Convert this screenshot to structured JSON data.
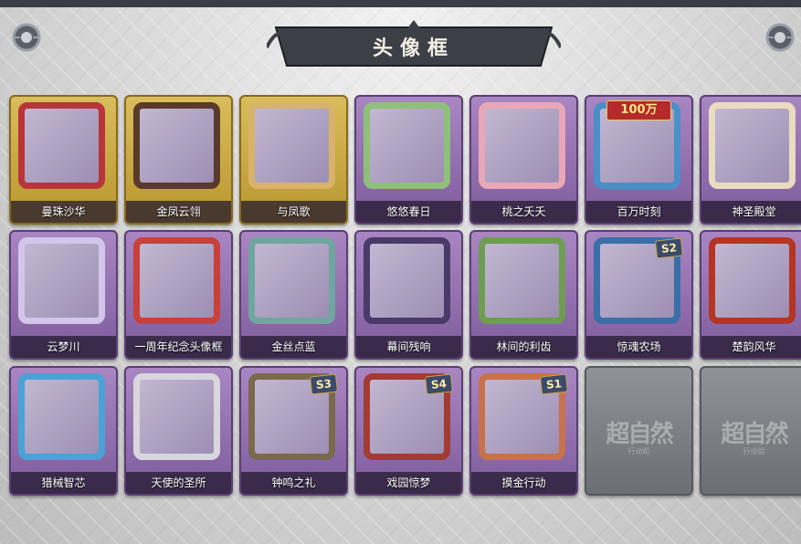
{
  "header": {
    "title": "头像框"
  },
  "colors": {
    "gold_card": "#c9a84a",
    "purple_card": "#9877b4",
    "locked_card": "#7d8186",
    "title_banner": "#3d3f46"
  },
  "frames": [
    {
      "label": "曼珠沙华",
      "style": "gold",
      "frame_color": "#b9353a",
      "icon": "spider-lily-icon"
    },
    {
      "label": "金凤云翎",
      "style": "gold",
      "frame_color": "#5a3a2a",
      "icon": "phoenix-feather-icon"
    },
    {
      "label": "与凤歌",
      "style": "gold",
      "frame_color": "#d8b36a",
      "icon": "phoenix-icon"
    },
    {
      "label": "悠悠春日",
      "style": "purple",
      "frame_color": "#8fc07a",
      "icon": "flower-icon"
    },
    {
      "label": "桃之夭夭",
      "style": "purple",
      "frame_color": "#e9a7b8",
      "icon": "peach-blossom-icon"
    },
    {
      "label": "百万时刻",
      "style": "purple",
      "frame_color": "#4a8fc8",
      "icon": "fox-icon",
      "badge_top": "100万"
    },
    {
      "label": "神圣殿堂",
      "style": "purple",
      "frame_color": "#e9dcc0",
      "icon": "heart-crest-icon"
    },
    {
      "label": "云梦川",
      "style": "purple",
      "frame_color": "#d2c6ea",
      "icon": "cloud-icon"
    },
    {
      "label": "一周年纪念头像框",
      "style": "purple",
      "frame_color": "#c8403a",
      "icon": "anniversary-cake-icon"
    },
    {
      "label": "金丝点蓝",
      "style": "purple",
      "frame_color": "#6fa6a0",
      "icon": "tulip-icon"
    },
    {
      "label": "幕间残响",
      "style": "purple",
      "frame_color": "#4a3a6a",
      "icon": "rose-icon"
    },
    {
      "label": "林间的利齿",
      "style": "purple",
      "frame_color": "#6d9e4f",
      "icon": "wolf-icon"
    },
    {
      "label": "惊魂农场",
      "style": "purple",
      "frame_color": "#3a6fa8",
      "icon": "sprout-icon",
      "badge": "S2"
    },
    {
      "label": "楚韵风华",
      "style": "purple",
      "frame_color": "#b53522",
      "icon": "flame-icon"
    },
    {
      "label": "猎械智芯",
      "style": "purple",
      "frame_color": "#4aa2d6",
      "icon": "circuit-icon"
    },
    {
      "label": "天使的圣所",
      "style": "purple",
      "frame_color": "#d7d7dd",
      "icon": "angel-wing-icon"
    },
    {
      "label": "钟鸣之礼",
      "style": "purple",
      "frame_color": "#7a6a4a",
      "icon": "dog-icon",
      "badge": "S3"
    },
    {
      "label": "戏园惊梦",
      "style": "purple",
      "frame_color": "#a33b34",
      "icon": "lantern-icon",
      "badge": "S4"
    },
    {
      "label": "摸金行动",
      "style": "purple",
      "frame_color": "#c9714a",
      "icon": "shovel-icon",
      "badge": "S1"
    },
    {
      "label": "",
      "style": "locked",
      "frame_color": "#8f9397",
      "icon": "locked-logo-icon",
      "lock_text": "超自然",
      "lock_sub": "行动组"
    },
    {
      "label": "",
      "style": "locked",
      "frame_color": "#8f9397",
      "icon": "locked-logo-icon",
      "lock_text": "超自然",
      "lock_sub": "行动组"
    }
  ]
}
